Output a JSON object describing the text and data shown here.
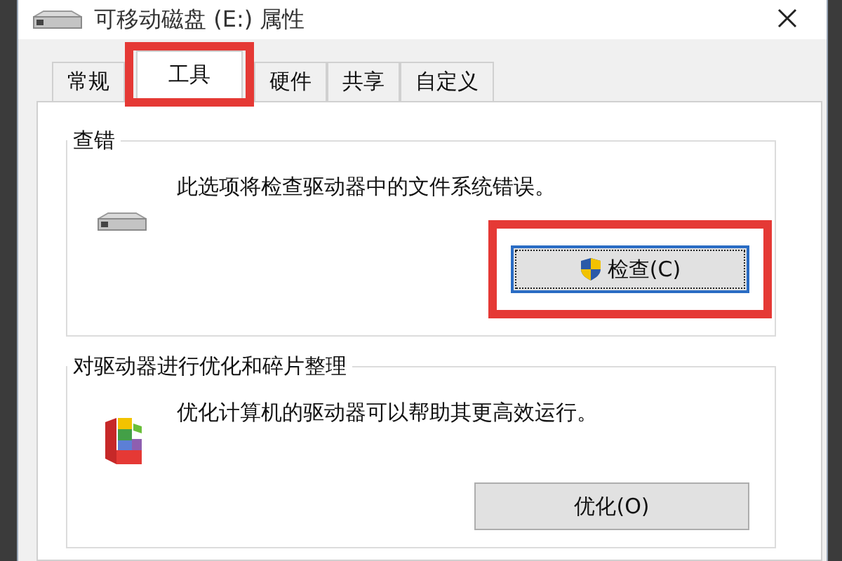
{
  "window": {
    "title": "可移动磁盘 (E:) 属性"
  },
  "tabs": [
    {
      "label": "常规",
      "selected": false,
      "highlighted": false
    },
    {
      "label": "工具",
      "selected": true,
      "highlighted": true
    },
    {
      "label": "硬件",
      "selected": false,
      "highlighted": false
    },
    {
      "label": "共享",
      "selected": false,
      "highlighted": false
    },
    {
      "label": "自定义",
      "selected": false,
      "highlighted": false
    }
  ],
  "groups": [
    {
      "kind": "error_check",
      "title": "查错",
      "description": "此选项将检查驱动器中的文件系统错误。",
      "button": {
        "label": "检查(C)",
        "focused": true,
        "highlighted": true
      }
    },
    {
      "kind": "optimize",
      "title": "对驱动器进行优化和碎片整理",
      "description": "优化计算机的驱动器可以帮助其更高效运行。",
      "button": {
        "label": "优化(O)",
        "focused": false,
        "highlighted": false
      }
    }
  ]
}
